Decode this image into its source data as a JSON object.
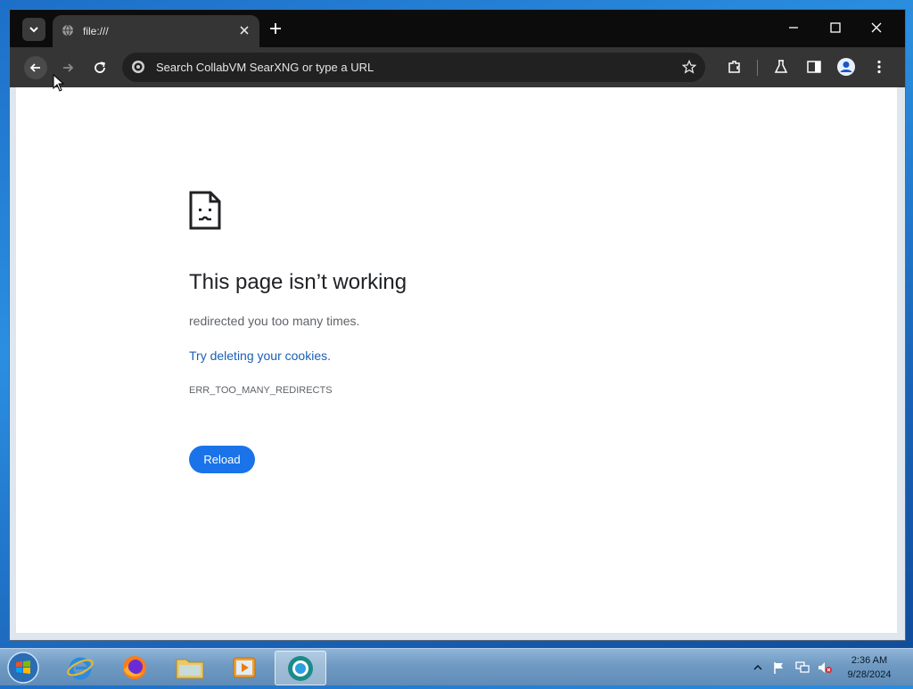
{
  "browser": {
    "tab_title": "file:///",
    "omnibox_placeholder": "Search CollabVM SearXNG or type a URL"
  },
  "error_page": {
    "title": "This page isn’t working",
    "description": "redirected you too many times.",
    "link_text": "Try deleting your cookies.",
    "error_code": "ERR_TOO_MANY_REDIRECTS",
    "reload_label": "Reload"
  },
  "taskbar": {
    "apps": [
      "internet-explorer",
      "firefox",
      "file-explorer",
      "media-player",
      "chromium"
    ],
    "clock_time": "2:36 AM",
    "clock_date": "9/28/2024"
  },
  "colors": {
    "link": "#1a5fb4",
    "button": "#1a73e8"
  }
}
